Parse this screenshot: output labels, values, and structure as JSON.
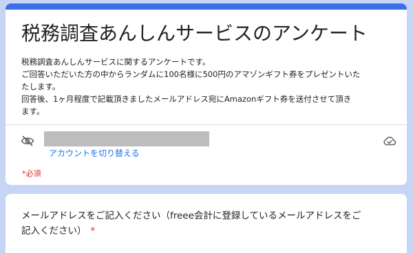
{
  "form": {
    "title": "税務調査あんしんサービスのアンケート",
    "description_lines": [
      "税務調査あんしんサービスに関するアンケートです。",
      "ご回答いただいた方の中からランダムに100名様に500円のアマゾンギフト券をプレゼントいた",
      "たします。",
      "回答後、1ヶ月程度で記載頂きましたメールアドレス宛にAmazonギフト券を送付させて頂き",
      "ます。"
    ],
    "switch_account": "アカウントを切り替える",
    "required_note": "*必須"
  },
  "icons": {
    "visibility": "eye-off-icon",
    "save_status": "cloud-check-icon"
  },
  "question": {
    "lines": [
      "メールアドレスをご記入ください（freee会計に登録しているメールアドレスをご",
      "記入ください）"
    ],
    "required_mark": "*"
  },
  "colors": {
    "accent": "#3c6ee6",
    "background": "#c6d5f4",
    "link": "#1a73e8",
    "required": "#d93025"
  }
}
